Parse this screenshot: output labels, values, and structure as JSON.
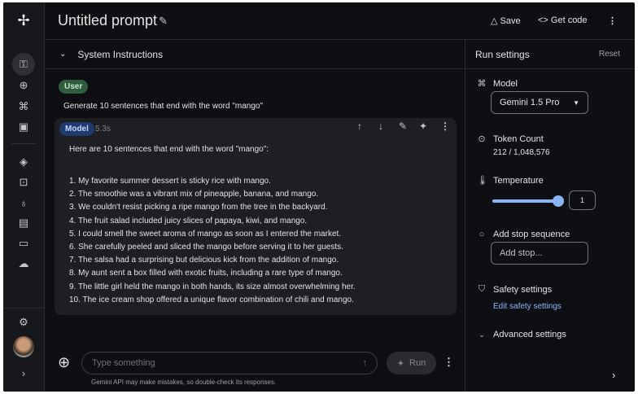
{
  "header": {
    "title": "Untitled prompt",
    "save": "Save",
    "get_code": "Get code"
  },
  "system_instructions": "System Instructions",
  "user": {
    "role": "User",
    "text": "Generate 10 sentences that end with the word \"mango\""
  },
  "model": {
    "role": "Model",
    "time": "5.3s",
    "intro": "Here are 10 sentences that end with the word \"mango\":",
    "items": [
      "1. My favorite summer dessert is sticky rice with mango.",
      "2. The smoothie was a vibrant mix of pineapple, banana, and mango.",
      "3. We couldn't resist picking a ripe mango from the tree in the backyard.",
      "4. The fruit salad included juicy slices of papaya, kiwi, and mango.",
      "5. I could smell the sweet aroma of mango as soon as I entered the market.",
      "6. She carefully peeled and sliced the mango before serving it to her guests.",
      "7. The salsa had a surprising but delicious kick from the addition of mango.",
      "8. My aunt sent a box filled with exotic fruits, including a rare type of mango.",
      "9. The little girl held the mango in both hands, its size almost overwhelming her.",
      "10. The ice cream shop offered a unique flavor combination of chili and mango."
    ]
  },
  "input": {
    "placeholder": "Type something",
    "run": "Run",
    "disclaimer": "Gemini API may make mistakes, so double-check its responses."
  },
  "run_settings": {
    "title": "Run settings",
    "reset": "Reset",
    "model_label": "Model",
    "model_value": "Gemini 1.5 Pro",
    "token_label": "Token Count",
    "token_value": "212 / 1,048,576",
    "temperature_label": "Temperature",
    "temperature_value": "1",
    "temperature_fraction": 1.0,
    "stop_label": "Add stop sequence",
    "stop_placeholder": "Add stop...",
    "safety_label": "Safety settings",
    "safety_link": "Edit safety settings",
    "advanced_label": "Advanced settings"
  },
  "colors": {
    "accent": "#8ab4f8",
    "user_chip": "#2e5e3e",
    "model_chip": "#1f3a6e"
  }
}
